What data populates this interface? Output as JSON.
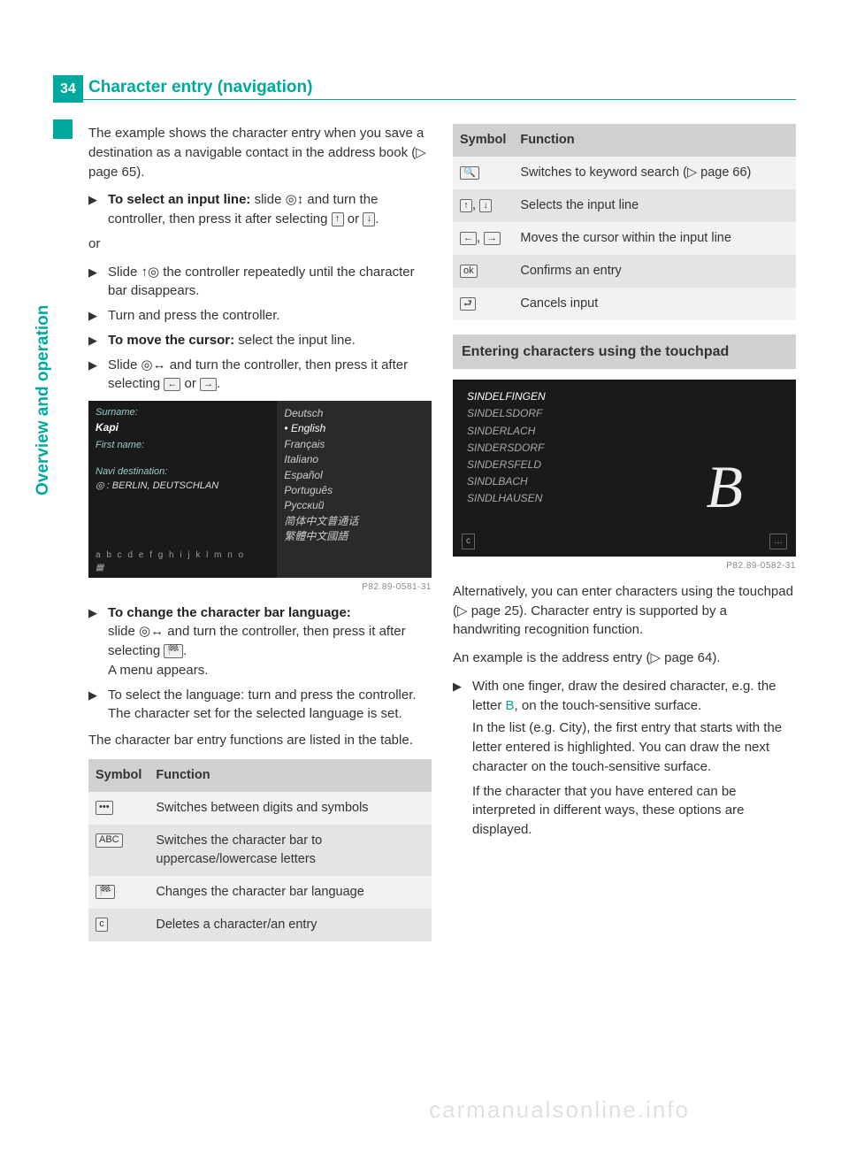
{
  "page_number": "34",
  "header_title": "Character entry (navigation)",
  "side_tab": "Overview and operation",
  "watermark": "carmanualsonline.info",
  "left": {
    "intro": "The example shows the character entry when you save a destination as a navigable contact in the address book (▷ page 65).",
    "b1_bold": "To select an input line:",
    "b1_rest": " slide ◎↕ and turn the controller, then press it after selecting ",
    "b1_or": " or ",
    "b1_end": ".",
    "or": "or",
    "b2": "Slide ↑◎ the controller repeatedly until the character bar disappears.",
    "b3": "Turn and press the controller.",
    "b4_bold": "To move the cursor:",
    "b4_rest": " select the input line.",
    "b5_a": "Slide ◎↔ and turn the controller, then press it after selecting ",
    "b5_or": " or ",
    "b5_end": ".",
    "screenshot1": {
      "surname_label": "Surname:",
      "surname_val": "Kapi",
      "firstname_label": "First name:",
      "navi_label": "Navi destination:",
      "navi_val": "◎ : BERLIN, DEUTSCHLAN",
      "charbar": "a b c d e f g h i j k l m n o",
      "langs": [
        "Deutsch",
        "English",
        "Français",
        "Italiano",
        "Español",
        "Português",
        "Русский",
        "简体中文普通话",
        "繁體中文國語"
      ],
      "caption": "P82.89-0581-31"
    },
    "b6_bold": "To change the character bar language:",
    "b6_l2a": "slide ◎↔ and turn the controller, then press it after selecting ",
    "b6_l2end": ".",
    "b6_l3": "A menu appears.",
    "b7_l1": "To select the language: turn and press the controller.",
    "b7_l2": "The character set for the selected language is set.",
    "outro": "The character bar entry functions are listed in the table.",
    "table": {
      "h1": "Symbol",
      "h2": "Function",
      "r1_sym": "•••",
      "r1_fn": "Switches between digits and symbols",
      "r2_sym": "ABC",
      "r2_fn": "Switches the character bar to uppercase/lowercase letters",
      "r3_sym": "🏁",
      "r3_fn": "Changes the character bar language",
      "r4_sym": "c",
      "r4_fn": "Deletes a character/an entry"
    }
  },
  "right": {
    "table": {
      "h1": "Symbol",
      "h2": "Function",
      "r1_sym": "🔍",
      "r1_fn": "Switches to keyword search (▷ page 66)",
      "r2_sym1": "↑",
      "r2_sym2": "↓",
      "r2_fn": "Selects the input line",
      "r3_sym1": "←",
      "r3_sym2": "→",
      "r3_fn": "Moves the cursor within the input line",
      "r4_sym": "ok",
      "r4_fn": "Confirms an entry",
      "r5_sym": "⮐",
      "r5_fn": "Cancels input"
    },
    "subheading": "Entering characters using the touchpad",
    "screenshot2": {
      "items": [
        "SINDELFINGEN",
        "SINDELSDORF",
        "SINDERLACH",
        "SINDERSDORF",
        "SINDERSFELD",
        "SINDLBACH",
        "SINDLHAUSEN"
      ],
      "bigletter": "B",
      "corner_l": "c",
      "corner_r": "…",
      "caption": "P82.89-0582-31"
    },
    "p1": "Alternatively, you can enter characters using the touchpad (▷ page 25). Character entry is supported by a handwriting recognition function.",
    "p2": "An example is the address entry (▷ page 64).",
    "b1_a": "With one finger, draw the desired character, e.g. the letter ",
    "b1_letter": "B",
    "b1_b": ", on the touch-sensitive surface.",
    "b1_c": "In the list (e.g. City), the first entry that starts with the letter entered is highlighted. You can draw the next character on the touch-sensitive surface.",
    "b1_d": "If the character that you have entered can be interpreted in different ways, these options are displayed."
  }
}
